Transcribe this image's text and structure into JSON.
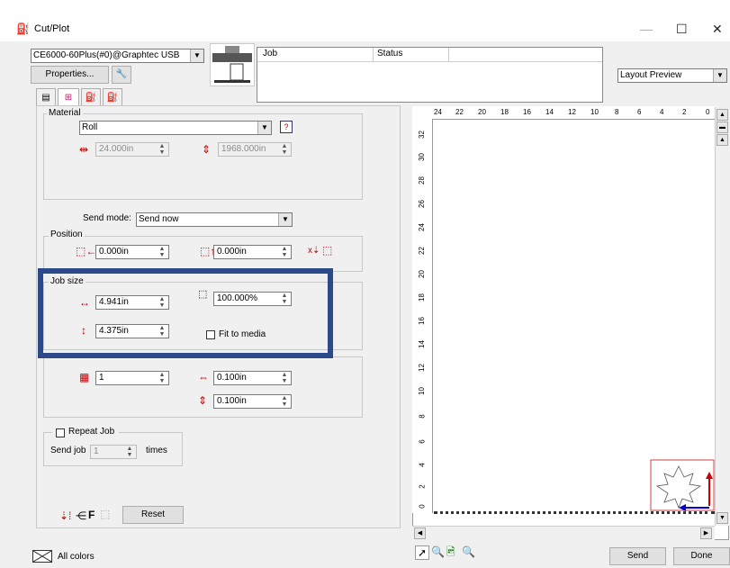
{
  "window": {
    "title": "Cut/Plot",
    "minimize": "—",
    "maximize": "☐",
    "close": "✕"
  },
  "device": {
    "selected": "CE6000-60Plus(#0)@Graphtec USB",
    "properties_label": "Properties..."
  },
  "job_table": {
    "headers": [
      "Job",
      "Status"
    ]
  },
  "view_select": "Layout Preview",
  "material": {
    "group_label": "Material",
    "type": "Roll",
    "width": "24.000in",
    "length": "1968.000in"
  },
  "send_mode": {
    "label": "Send mode:",
    "value": "Send now"
  },
  "position": {
    "group_label": "Position",
    "x": "0.000in",
    "y": "0.000in"
  },
  "job_size": {
    "group_label": "Job size",
    "width": "4.941in",
    "height": "4.375in",
    "scale": "100.000%",
    "fit_label": "Fit to media",
    "fit_checked": false
  },
  "copies": {
    "count": "1",
    "spacing_h": "0.100in",
    "spacing_v": "0.100in"
  },
  "repeat": {
    "label": "Repeat Job",
    "checked": false,
    "send_job_label": "Send job",
    "times_value": "1",
    "times_label": "times"
  },
  "reset_label": "Reset",
  "f_label": "F",
  "footer": {
    "all_colors": "All colors",
    "send": "Send",
    "done": "Done"
  },
  "ruler": {
    "h_ticks": [
      "24",
      "22",
      "20",
      "18",
      "16",
      "14",
      "12",
      "10",
      "8",
      "6",
      "4",
      "2",
      "0"
    ],
    "v_ticks": [
      "32",
      "30",
      "28",
      "26",
      "24",
      "22",
      "20",
      "18",
      "16",
      "14",
      "12",
      "10",
      "8",
      "6",
      "4",
      "2",
      "0"
    ]
  },
  "colors": {
    "highlight": "#2c4a8a",
    "arrow_red": "#cc0000",
    "arrow_blue": "#0000cc"
  }
}
